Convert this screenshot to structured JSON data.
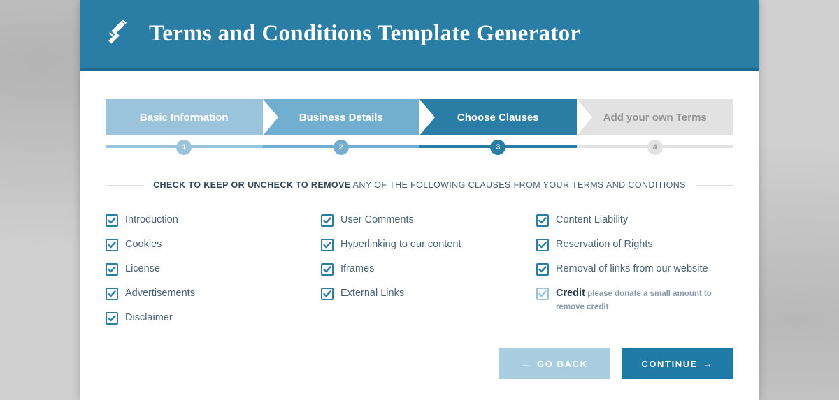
{
  "header": {
    "title": "Terms and Conditions Template Generator"
  },
  "steps": [
    {
      "label": "Basic Information",
      "num": "1"
    },
    {
      "label": "Business Details",
      "num": "2"
    },
    {
      "label": "Choose Clauses",
      "num": "3"
    },
    {
      "label": "Add your own Terms",
      "num": "4"
    }
  ],
  "instruction": {
    "strong": "CHECK TO KEEP OR UNCHECK TO REMOVE",
    "rest": " ANY OF THE FOLLOWING CLAUSES FROM YOUR TERMS AND CONDITIONS"
  },
  "clauses": {
    "col1": [
      {
        "label": "Introduction"
      },
      {
        "label": "Cookies"
      },
      {
        "label": "License"
      },
      {
        "label": "Advertisements"
      },
      {
        "label": "Disclaimer"
      }
    ],
    "col2": [
      {
        "label": "User Comments"
      },
      {
        "label": "Hyperlinking to our content"
      },
      {
        "label": "Iframes"
      },
      {
        "label": "External Links"
      }
    ],
    "col3": [
      {
        "label": "Content Liability"
      },
      {
        "label": "Reservation of Rights"
      },
      {
        "label": "Removal of links from our website"
      },
      {
        "label": "Credit",
        "bold": true,
        "dim": true,
        "note": " please donate a small amount to remove credit"
      }
    ]
  },
  "buttons": {
    "back": "GO BACK",
    "continue": "CONTINUE"
  }
}
